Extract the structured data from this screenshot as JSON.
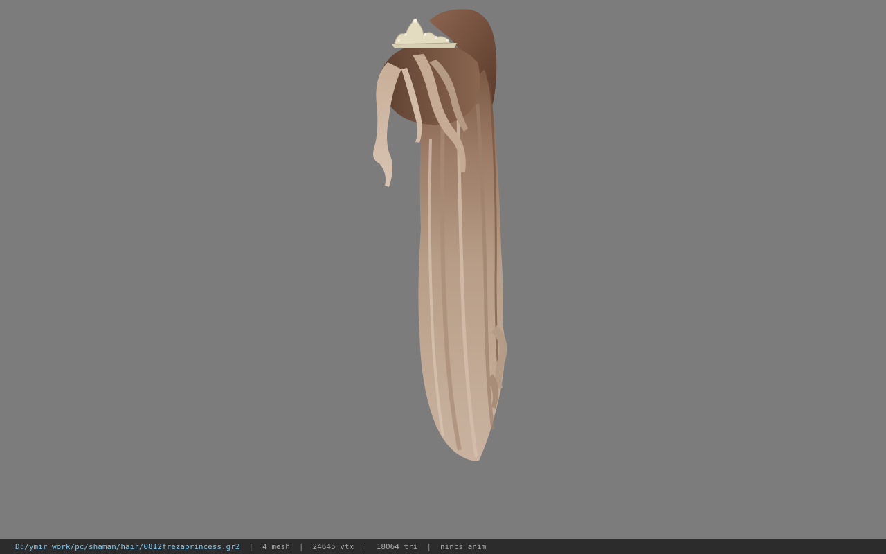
{
  "viewer": {
    "background_color": "#7c7c7c",
    "model_description_icon": "hair-model-with-tiara"
  },
  "statusbar": {
    "file_path": "D:/ymir work/pc/shaman/hair/0812frezaprincess.gr2",
    "mesh_count": "4 mesh",
    "vertex_count": "24645 vtx",
    "triangle_count": "18064 tri",
    "animation": "nincs anim",
    "separator": "|",
    "path_color": "#7fc3e6"
  }
}
